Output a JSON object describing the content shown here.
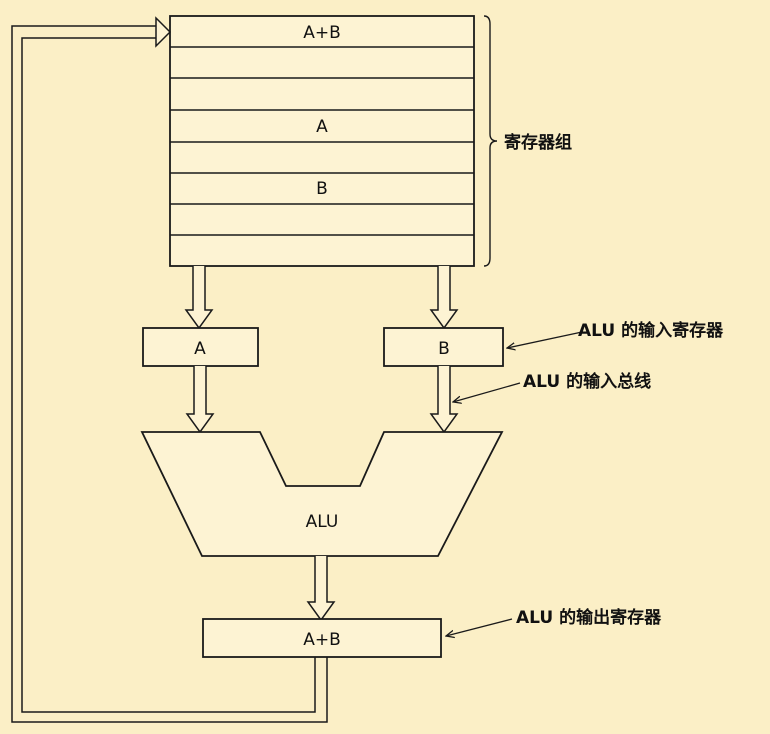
{
  "register_file": {
    "label": "寄存器组",
    "rows": [
      "A+B",
      "",
      "",
      "A",
      "",
      "B",
      "",
      ""
    ]
  },
  "alu_input_registers": {
    "a": "A",
    "b": "B",
    "annotation": "ALU 的输入寄存器"
  },
  "alu_input_bus": {
    "annotation": "ALU 的输入总线"
  },
  "alu": {
    "label": "ALU"
  },
  "alu_output_register": {
    "value": "A+B",
    "annotation": "ALU 的输出寄存器"
  },
  "colors": {
    "background": "#fbefc6",
    "box_fill": "#fdf3d3",
    "line": "#1a1a1a"
  }
}
